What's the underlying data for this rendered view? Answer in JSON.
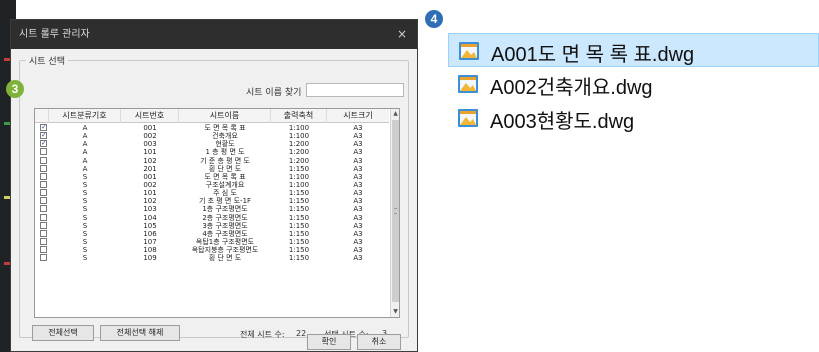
{
  "dialog": {
    "title": "시트 롤루 관리자",
    "close_glyph": "×",
    "group_label": "시트 선택",
    "search_label": "시트 이름 찾기",
    "search_value": ""
  },
  "table": {
    "headers": [
      "시트분류기호",
      "시트번호",
      "시트이름",
      "출력축척",
      "시트크기"
    ],
    "rows": [
      {
        "checked": true,
        "cls": "A",
        "no": "001",
        "name": "도 면 목 록 표",
        "scale": "1:100",
        "size": "A3"
      },
      {
        "checked": true,
        "cls": "A",
        "no": "002",
        "name": "건축개요",
        "scale": "1:100",
        "size": "A3"
      },
      {
        "checked": true,
        "cls": "A",
        "no": "003",
        "name": "현황도",
        "scale": "1:200",
        "size": "A3"
      },
      {
        "checked": false,
        "cls": "A",
        "no": "101",
        "name": "1 층 평 면 도",
        "scale": "1:200",
        "size": "A3"
      },
      {
        "checked": false,
        "cls": "A",
        "no": "102",
        "name": "기 준 층 평 면 도",
        "scale": "1:200",
        "size": "A3"
      },
      {
        "checked": false,
        "cls": "A",
        "no": "201",
        "name": "횡 단 면 도",
        "scale": "1:150",
        "size": "A3"
      },
      {
        "checked": false,
        "cls": "S",
        "no": "001",
        "name": "도 면 목 록 표",
        "scale": "1:100",
        "size": "A3"
      },
      {
        "checked": false,
        "cls": "S",
        "no": "002",
        "name": "구조설계개요",
        "scale": "1:100",
        "size": "A3"
      },
      {
        "checked": false,
        "cls": "S",
        "no": "101",
        "name": "주   심   도",
        "scale": "1:150",
        "size": "A3"
      },
      {
        "checked": false,
        "cls": "S",
        "no": "102",
        "name": "기 초 평 면 도-1F",
        "scale": "1:150",
        "size": "A3"
      },
      {
        "checked": false,
        "cls": "S",
        "no": "103",
        "name": "1층 구조평면도",
        "scale": "1:150",
        "size": "A3"
      },
      {
        "checked": false,
        "cls": "S",
        "no": "104",
        "name": "2층 구조평면도",
        "scale": "1:150",
        "size": "A3"
      },
      {
        "checked": false,
        "cls": "S",
        "no": "105",
        "name": "3층 구조평면도",
        "scale": "1:150",
        "size": "A3"
      },
      {
        "checked": false,
        "cls": "S",
        "no": "106",
        "name": "4층 구조평면도",
        "scale": "1:150",
        "size": "A3"
      },
      {
        "checked": false,
        "cls": "S",
        "no": "107",
        "name": "옥탑1층 구조평면도",
        "scale": "1:150",
        "size": "A3"
      },
      {
        "checked": false,
        "cls": "S",
        "no": "108",
        "name": "옥탑지붕층 구조평면도",
        "scale": "1:150",
        "size": "A3"
      },
      {
        "checked": false,
        "cls": "S",
        "no": "109",
        "name": "횡 단 면 도",
        "scale": "1:150",
        "size": "A3"
      }
    ]
  },
  "buttons": {
    "select_all": "전체선택",
    "deselect_all": "전체선택 해제",
    "ok": "확인",
    "cancel": "취소"
  },
  "counts": {
    "total_label": "전체 시트 수:",
    "total_value": "22",
    "selected_label": "선택 시트 수:",
    "selected_value": "3"
  },
  "files": [
    {
      "name": "A001도 면 목 록 표.dwg",
      "selected": true
    },
    {
      "name": "A002건축개요.dwg",
      "selected": false
    },
    {
      "name": "A003현황도.dwg",
      "selected": false
    }
  ],
  "callouts": {
    "table": "3",
    "files": "4"
  },
  "colors": {
    "callout_table": "#7fb23a",
    "callout_files": "#2f6eb5",
    "selection": "#cce8ff"
  }
}
